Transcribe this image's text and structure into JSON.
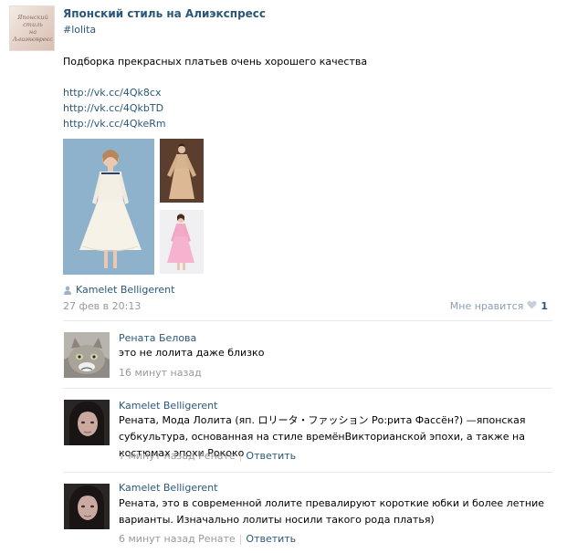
{
  "post": {
    "group_name": "Японский стиль на Алиэкспресс",
    "avatar_line1": "Японский стиль",
    "avatar_line2": "на Алиэкспресс",
    "hashtag": "#lolita",
    "text": "Подборка прекрасных платьев очень хорошего качества",
    "links": [
      "http://vk.cc/4Qk8cx",
      "http://vk.cc/4QkbTD",
      "http://vk.cc/4QkeRm"
    ],
    "author": "Kamelet Belligerent",
    "date": "27 фев в 20:13",
    "like_label": "Мне нравится",
    "like_count": "1"
  },
  "comments": [
    {
      "name": "Рената Белова",
      "text": "это не лолита даже близко",
      "time": "16 минут назад",
      "reply": ""
    },
    {
      "name": "Kamelet Belligerent",
      "text": "Рената, Мода Лолита (яп. ロリータ・ファッション Ро:рита Фассён?) —японская субкультура, основанная на стиле времёнВикторианской эпохи, а также на костюмах эпохи Рококо",
      "time": "7 минут назад Ренате",
      "reply": "Ответить"
    },
    {
      "name": "Kamelet Belligerent",
      "text": "Рената, это в современной лолите превалируют короткие юбки и более летние варианты. Изначально лолиты носили такого рода платья)",
      "time": "6 минут назад Ренате",
      "reply": "Ответить"
    }
  ],
  "colors": {
    "link": "#2b587a",
    "meta": "#999999",
    "divider": "#e7e9ec",
    "heart": "#c7d0da"
  }
}
